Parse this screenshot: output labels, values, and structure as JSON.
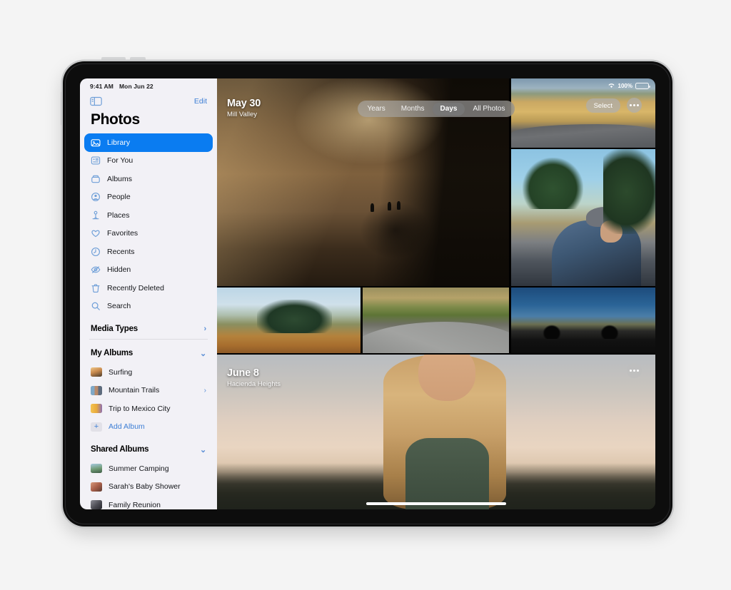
{
  "device": {
    "name": "iPad Pro"
  },
  "status_bar": {
    "time": "9:41 AM",
    "date": "Mon Jun 22",
    "wifi_icon": "wifi-icon",
    "battery_percent": "100%",
    "battery_icon": "battery-full-icon"
  },
  "sidebar": {
    "toggle_icon": "sidebar-toggle-icon",
    "edit_label": "Edit",
    "title": "Photos",
    "nav_items": [
      {
        "label": "Library",
        "icon": "photo-library-icon",
        "selected": true
      },
      {
        "label": "For You",
        "icon": "for-you-icon",
        "selected": false
      },
      {
        "label": "Albums",
        "icon": "albums-icon",
        "selected": false
      },
      {
        "label": "People",
        "icon": "people-icon",
        "selected": false
      },
      {
        "label": "Places",
        "icon": "places-pin-icon",
        "selected": false
      },
      {
        "label": "Favorites",
        "icon": "heart-icon",
        "selected": false
      },
      {
        "label": "Recents",
        "icon": "clock-icon",
        "selected": false
      },
      {
        "label": "Hidden",
        "icon": "eye-slash-icon",
        "selected": false
      },
      {
        "label": "Recently Deleted",
        "icon": "trash-icon",
        "selected": false
      },
      {
        "label": "Search",
        "icon": "search-icon",
        "selected": false
      }
    ],
    "sections": [
      {
        "title": "Media Types",
        "chevron": "chevron-right-icon",
        "chevron_glyph": "›",
        "items": []
      },
      {
        "title": "My Albums",
        "chevron": "chevron-down-icon",
        "chevron_glyph": "⌄",
        "items": [
          {
            "label": "Surfing",
            "thumb": "#8a6f4e",
            "chevron": false
          },
          {
            "label": "Mountain Trails",
            "thumb": "#5d7c9c",
            "chevron": true
          },
          {
            "label": "Trip to Mexico City",
            "thumb": "#e0a93f",
            "chevron": false
          }
        ],
        "add_label": "Add Album",
        "add_icon": "plus-icon"
      },
      {
        "title": "Shared Albums",
        "chevron": "chevron-down-icon",
        "chevron_glyph": "⌄",
        "items": [
          {
            "label": "Summer Camping",
            "thumb": "#6a8a6d",
            "chevron": false
          },
          {
            "label": "Sarah's Baby Shower",
            "thumb": "#a9705c",
            "chevron": false
          },
          {
            "label": "Family Reunion",
            "thumb": "#4b4b52",
            "chevron": false
          }
        ]
      }
    ]
  },
  "main": {
    "segmented_control": {
      "options": [
        "Years",
        "Months",
        "Days",
        "All Photos"
      ],
      "selected": "Days"
    },
    "select_label": "Select",
    "more_icon": "ellipsis-icon",
    "day_groups": [
      {
        "date": "May 30",
        "location": "Mill Valley",
        "photos": [
          {
            "name": "forest-cyclists-photo",
            "alt": "Cyclists on a misty forest road at sunrise"
          },
          {
            "name": "golden-grass-road-photo",
            "alt": "Cyclists on a road beside golden grass"
          },
          {
            "name": "cyclist-portrait-photo",
            "alt": "Cyclist in helmet riding uphill"
          },
          {
            "name": "foggy-forest-photo",
            "alt": "Fog over autumn trees"
          },
          {
            "name": "winding-road-photo",
            "alt": "Cyclists on a winding country road"
          },
          {
            "name": "cyclist-silhouette-photo",
            "alt": "Two cyclist silhouettes against blue sky"
          }
        ]
      },
      {
        "date": "June 8",
        "location": "Hacienda Heights",
        "photos": [
          {
            "name": "sunset-portrait-photo",
            "alt": "Woman with blonde hair at sunset with palm trees"
          }
        ]
      }
    ],
    "home_indicator": "home-indicator"
  },
  "colors": {
    "accent": "#0a7cf1",
    "link": "#3e7fd5",
    "sidebar_bg": "#f2f1f6",
    "page_bg": "#f4f4f4"
  }
}
